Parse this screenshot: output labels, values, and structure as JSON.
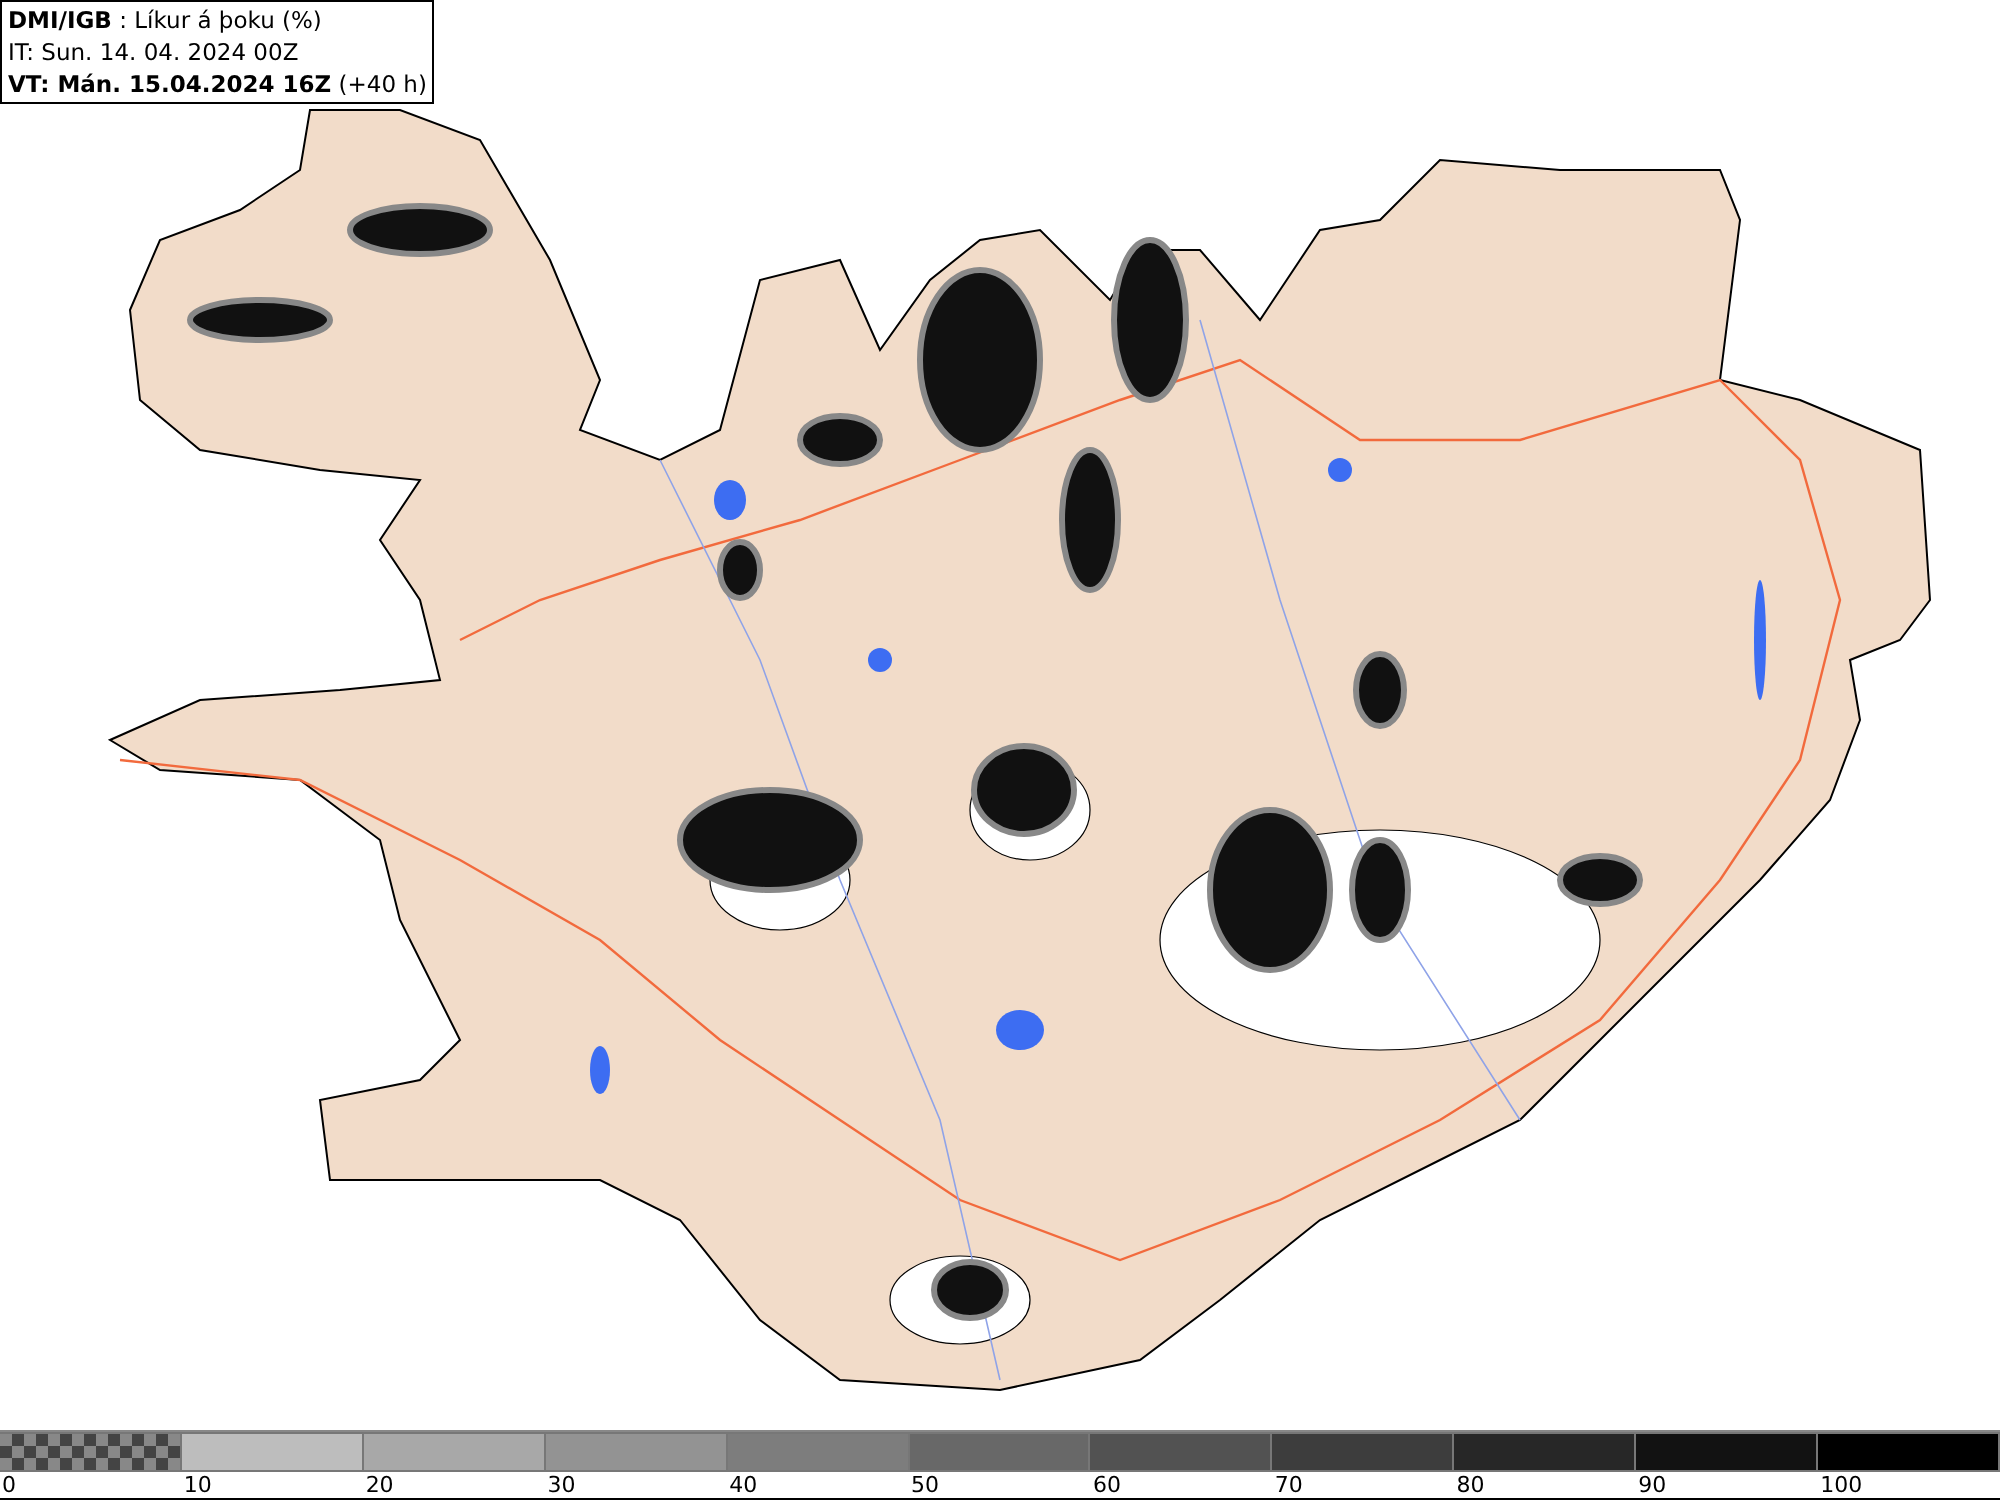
{
  "header": {
    "lines": [
      "**DMI/IGB** : Líkur á þoku (%)",
      "IT: Sun. 14. 04. 2024 00Z",
      "**VT: Mán. 15.04.2024 16Z** (+40 h)"
    ]
  },
  "legend": {
    "segments": [
      {
        "kind": "pattern"
      },
      {
        "kind": "solid",
        "color": "#bdbdbd"
      },
      {
        "kind": "solid",
        "color": "#a8a8a8"
      },
      {
        "kind": "solid",
        "color": "#939393"
      },
      {
        "kind": "solid",
        "color": "#7d7d7d"
      },
      {
        "kind": "solid",
        "color": "#686868"
      },
      {
        "kind": "solid",
        "color": "#525252"
      },
      {
        "kind": "solid",
        "color": "#3d3d3d"
      },
      {
        "kind": "solid",
        "color": "#272727"
      },
      {
        "kind": "solid",
        "color": "#121212"
      },
      {
        "kind": "solid",
        "color": "#000000"
      }
    ],
    "labels": [
      "0",
      "10",
      "20",
      "30",
      "40",
      "50",
      "60",
      "70",
      "80",
      "90",
      "100"
    ]
  }
}
